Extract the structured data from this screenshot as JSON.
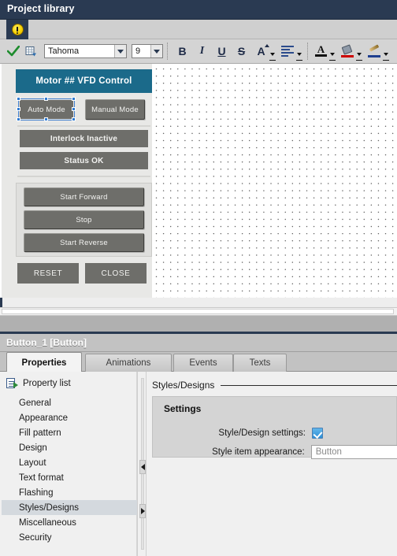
{
  "window": {
    "title": "Project library"
  },
  "toolbar": {
    "warning_icon": "warning-icon",
    "apply_icon": "green-check-icon",
    "grid_icon": "insert-object-icon",
    "font_family": "Tahoma",
    "font_size": "9",
    "bold": "B",
    "italic": "I",
    "underline": "U",
    "strikethrough": "S",
    "font_scale": "A",
    "align_icon": "align-left-icon",
    "font_color_letter": "A",
    "font_color_hex": "#111111",
    "fill_color_icon": "fill-bucket-icon",
    "fill_color_hex": "#cc0000",
    "line_color_icon": "pen-icon",
    "line_color_hex": "#1f3f8f"
  },
  "hmi": {
    "header": "Motor ## VFD Control",
    "mode_buttons": [
      {
        "label": "Auto Mode",
        "selected": true
      },
      {
        "label": "Manual Mode",
        "selected": false
      }
    ],
    "status_buttons": [
      {
        "label": "Interlock Inactive"
      },
      {
        "label": "Status OK"
      }
    ],
    "command_buttons": [
      {
        "label": "Start Forward"
      },
      {
        "label": "Stop"
      },
      {
        "label": "Start Reverse"
      }
    ],
    "footer_buttons": [
      {
        "label": "RESET"
      },
      {
        "label": "CLOSE"
      }
    ],
    "colors": {
      "header_bg": "#1b6a8a",
      "button_bg": "#6e6e6a",
      "screen_bg": "#e8e8e6",
      "selection_handle": "#2f7ad0"
    }
  },
  "inspector": {
    "header_title": "Button_1 [Button]",
    "tabs": [
      {
        "label": "Properties",
        "active": true
      },
      {
        "label": "Animations",
        "active": false
      },
      {
        "label": "Events",
        "active": false
      },
      {
        "label": "Texts",
        "active": false
      }
    ],
    "property_list_label": "Property list",
    "property_items": [
      {
        "label": "General",
        "selected": false
      },
      {
        "label": "Appearance",
        "selected": false
      },
      {
        "label": "Fill pattern",
        "selected": false
      },
      {
        "label": "Design",
        "selected": false
      },
      {
        "label": "Layout",
        "selected": false
      },
      {
        "label": "Text format",
        "selected": false
      },
      {
        "label": "Flashing",
        "selected": false
      },
      {
        "label": "Styles/Designs",
        "selected": true
      },
      {
        "label": "Miscellaneous",
        "selected": false
      },
      {
        "label": "Security",
        "selected": false
      }
    ],
    "section_title": "Styles/Designs",
    "settings": {
      "group_title": "Settings",
      "style_design_label": "Style/Design settings:",
      "style_design_checked": true,
      "style_item_label": "Style item appearance:",
      "style_item_value": "Button"
    }
  }
}
